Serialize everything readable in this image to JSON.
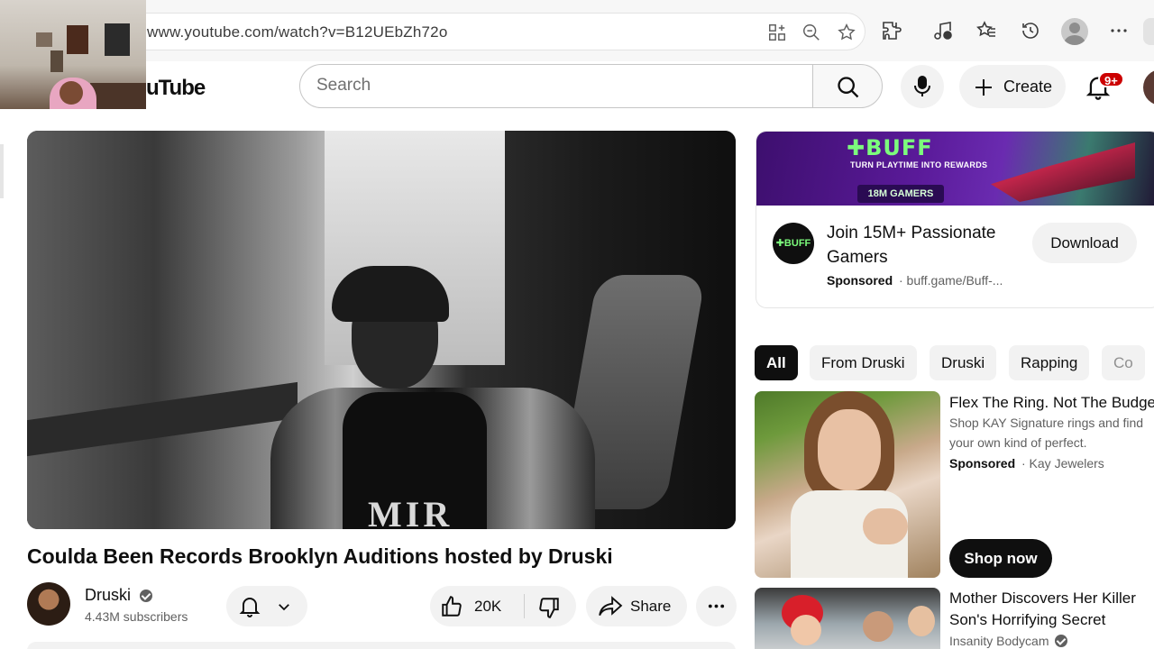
{
  "browser": {
    "url": "www.youtube.com/watch?v=B12UEbZh72o"
  },
  "header": {
    "logo_text": "uTube",
    "search_placeholder": "Search",
    "create_label": "Create",
    "notification_count": "9+"
  },
  "video": {
    "title": "Coulda Been Records Brooklyn Auditions hosted by Druski",
    "overlay_text": "MIR",
    "channel_name": "Druski",
    "subscribers": "4.43M subscribers",
    "like_count": "20K",
    "share_label": "Share"
  },
  "ad": {
    "banner_logo": "✚BUFF",
    "banner_tagline": "TURN PLAYTIME INTO REWARDS",
    "banner_gamers": "18M GAMERS",
    "logo_text": "✚BUFF",
    "title": "Join 15M+ Passionate Gamers",
    "sponsored": "Sponsored",
    "url": "· buff.game/Buff-...",
    "cta": "Download"
  },
  "chips": [
    "All",
    "From Druski",
    "Druski",
    "Rapping",
    "Co"
  ],
  "sidebar": {
    "items": [
      {
        "title": "Flex The Ring. Not The Budge",
        "desc_line1": "Shop KAY Signature rings and find",
        "desc_line2": "your own kind of perfect.",
        "sponsored": "Sponsored",
        "advertiser": "· Kay Jewelers",
        "cta": "Shop now"
      },
      {
        "title_line1": "Mother Discovers Her Killer",
        "title_line2": "Son's Horrifying Secret",
        "channel": "Insanity Bodycam"
      }
    ]
  },
  "colors": {
    "accent_red": "#cc0000",
    "text_primary": "#0f0f0f",
    "text_secondary": "#606060",
    "chip_bg": "#f2f2f2"
  }
}
